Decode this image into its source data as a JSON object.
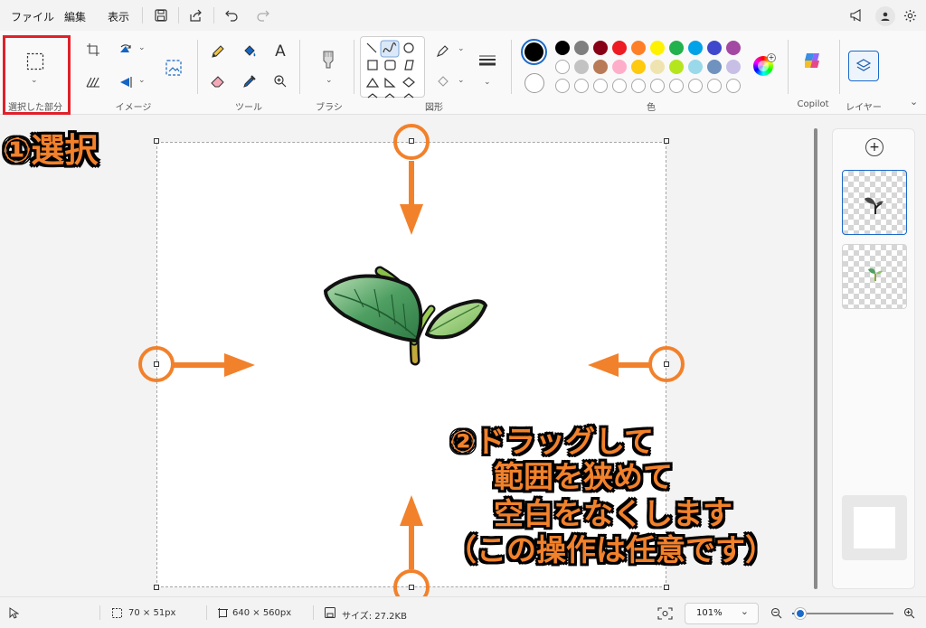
{
  "menubar": {
    "file": "ファイル",
    "edit": "編集",
    "view": "表示"
  },
  "ribbon": {
    "select_label": "選択した部分",
    "image_label": "イメージ",
    "tools_label": "ツール",
    "brush_label": "ブラシ",
    "shapes_label": "図形",
    "color_label": "色",
    "copilot_label": "Copilot",
    "layers_label": "レイヤー",
    "text_tool_glyph": "A"
  },
  "palette": {
    "row1": [
      "#000000",
      "#7f7f7f",
      "#880015",
      "#ed1c24",
      "#ff7f27",
      "#fff200",
      "#22b14c",
      "#00a2e8",
      "#3f48cc",
      "#a349a4"
    ],
    "row2": [
      "#ffffff",
      "#c3c3c3",
      "#b97a57",
      "#ffaec9",
      "#ffc90e",
      "#efe4b0",
      "#b5e61d",
      "#99d9ea",
      "#7092be",
      "#c8bfe7"
    ],
    "primary": "#000000",
    "secondary": "#ffffff",
    "accent": "#f2812b",
    "selection_highlight": "#e0202a"
  },
  "annotations": {
    "step1": "①選択",
    "step2_lines": [
      "②ドラッグして",
      "範囲を狭めて",
      "空白をなくします",
      "（この操作は任意です）"
    ]
  },
  "status": {
    "selection_size": "70 × 51px",
    "canvas_size": "640 × 560px",
    "file_size": "サイズ: 27.2KB",
    "zoom": "101%",
    "zoom_level": 0.08
  },
  "layers": {
    "add_glyph": "+"
  }
}
